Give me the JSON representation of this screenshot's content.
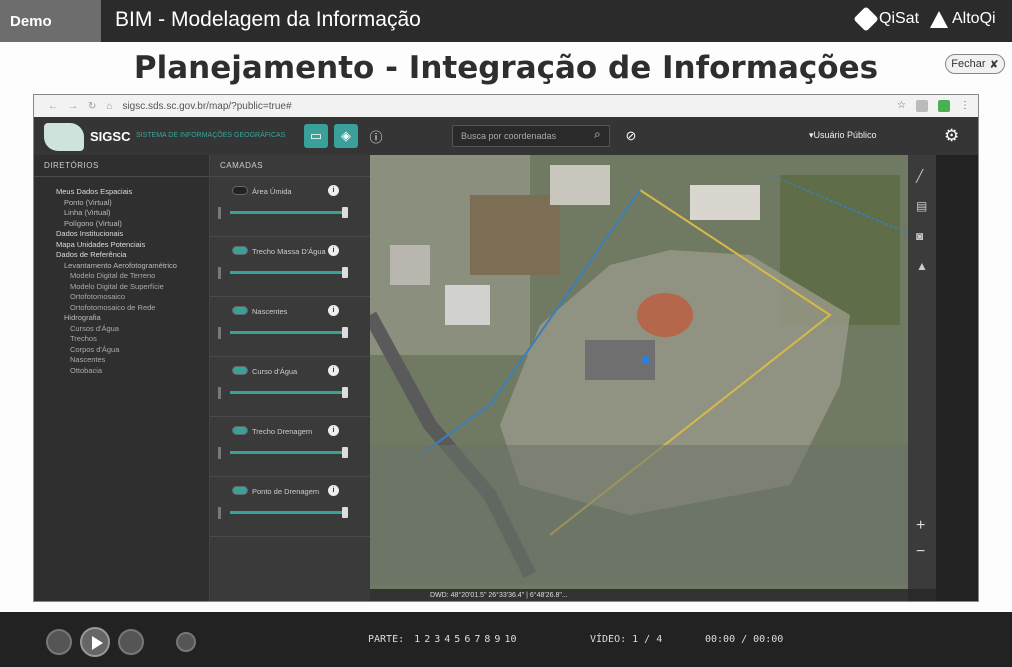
{
  "topbar": {
    "demo_label": "Demo",
    "course_title": "BIM - Modelagem da Informação",
    "brands": [
      "QiSat",
      "AltoQi"
    ]
  },
  "slide": {
    "title": "Planejamento - Integração de Informações",
    "close_label": "Fechar"
  },
  "browser": {
    "url": "sigsc.sds.sc.gov.br/map/?public=true#"
  },
  "app": {
    "name": "SIGSC",
    "subtitle": "SISTEMA DE INFORMAÇÕES GEOGRÁFICAS",
    "search_placeholder": "Busca por coordenadas",
    "user": "▾Usuário Público"
  },
  "directories": {
    "header": "DIRETÓRIOS",
    "items": [
      {
        "label": "Meus Dados Espaciais",
        "level": 1
      },
      {
        "label": "Ponto (Virtual)",
        "level": 2
      },
      {
        "label": "Linha (Virtual)",
        "level": 2
      },
      {
        "label": "Polígono (Virtual)",
        "level": 2
      },
      {
        "label": "Dados Institucionais",
        "level": 1
      },
      {
        "label": "Mapa Unidades Potenciais",
        "level": 1
      },
      {
        "label": "Dados de Referência",
        "level": 1
      },
      {
        "label": "Levantamento Aerofotogramétrico",
        "level": 2
      },
      {
        "label": "Modelo Digital de Terreno",
        "level": 3
      },
      {
        "label": "Modelo Digital de Superfície",
        "level": 3
      },
      {
        "label": "Ortofotomosaico",
        "level": 3
      },
      {
        "label": "Ortofotomosaico de Rede",
        "level": 3
      },
      {
        "label": "Hidrografia",
        "level": 2
      },
      {
        "label": "Cursos d'Água",
        "level": 3
      },
      {
        "label": "Trechos",
        "level": 3
      },
      {
        "label": "Corpos d'Água",
        "level": 3
      },
      {
        "label": "Nascentes",
        "level": 3
      },
      {
        "label": "Ottobacia",
        "level": 3
      }
    ]
  },
  "layers": {
    "header": "CAMADAS",
    "items": [
      {
        "label": "Área Úmida",
        "on": false
      },
      {
        "label": "Trecho Massa D'Água",
        "on": true
      },
      {
        "label": "Nascentes",
        "on": true
      },
      {
        "label": "Curso d'Água",
        "on": true
      },
      {
        "label": "Trecho Drenagem",
        "on": true
      },
      {
        "label": "Ponto de Drenagem",
        "on": true
      }
    ]
  },
  "map": {
    "status_text": "DWD: 48°20'01.5\" 26°33'36.4\" | 6°48'26.8\"...",
    "colors": {
      "boundary": "#d7b94a",
      "waterline": "#3b7fb8",
      "marker": "#2b7fe0"
    }
  },
  "player": {
    "part_label": "PARTE:",
    "parts": [
      "1",
      "2",
      "3",
      "4",
      "5",
      "6",
      "7",
      "8",
      "9",
      "10"
    ],
    "video_label": "VÍDEO: 1 / 4",
    "time": "00:00 / 00:00"
  }
}
